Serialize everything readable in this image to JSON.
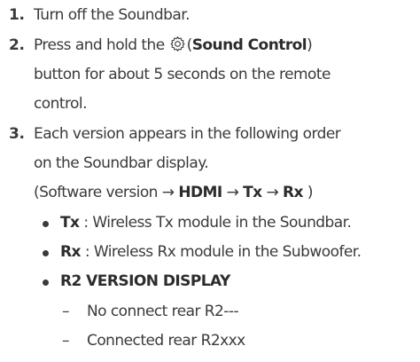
{
  "steps": [
    {
      "number": "1.",
      "text": "Turn off the Soundbar."
    },
    {
      "number": "2.",
      "pre": "Press and hold the",
      "icon": "gear-icon",
      "bold": "Sound Control",
      "post": "button for about 5 seconds on the remote",
      "line3": "control."
    },
    {
      "number": "3.",
      "line1": "Each version appears in the following order",
      "line2": "on the Soundbar display.",
      "seq": {
        "open": "(Software version →",
        "hdmi": "HDMI",
        "tx": "Tx",
        "rx": "Rx",
        "close": ")",
        "arrow": "→"
      }
    }
  ],
  "bullets": [
    {
      "bold": "Tx",
      "text": ": Wireless Tx module in the Soundbar."
    },
    {
      "bold": "Rx",
      "text": ": Wireless Rx module in the Subwoofer."
    },
    {
      "bold": "R2 VERSION DISPLAY"
    }
  ],
  "subitems": [
    {
      "dash": "–",
      "text": "No connect rear R2---"
    },
    {
      "dash": "–",
      "text": "Connected rear R2xxx"
    }
  ]
}
